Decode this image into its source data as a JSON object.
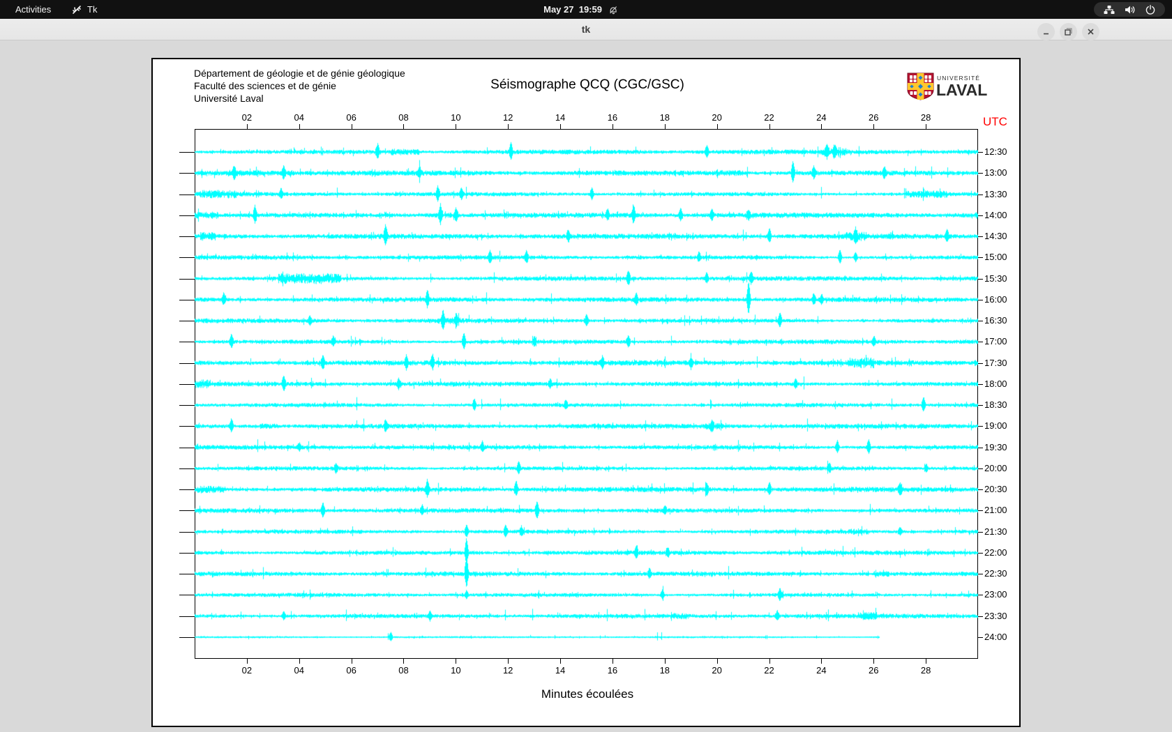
{
  "desktop": {
    "top_bar": {
      "activities_label": "Activities",
      "app_name": "Tk",
      "clock": "May 27  19:59",
      "icons": [
        "do-not-disturb-bell-icon",
        "network-icon",
        "volume-icon",
        "power-icon"
      ]
    },
    "window": {
      "title": "tk",
      "controls": [
        "minimize",
        "maximize",
        "close"
      ]
    }
  },
  "seismograph": {
    "header_lines": [
      "Département de géologie et de génie géologique",
      "Faculté des sciences et de génie",
      "Université Laval"
    ],
    "title": "Séismographe QCQ (CGC/GSC)",
    "logo": {
      "small": "UNIVERSITÉ",
      "large": "LAVAL"
    },
    "utc_label": "UTC",
    "utc_color": "#ff0000",
    "trace_color": "#00ffff",
    "xlabel": "Minutes écoulées",
    "x_ticks": [
      "02",
      "04",
      "06",
      "08",
      "10",
      "12",
      "14",
      "16",
      "18",
      "20",
      "22",
      "24",
      "26",
      "28"
    ],
    "x_range_minutes": [
      0,
      30
    ],
    "traces": [
      {
        "label": "12:30",
        "noise": 1.7,
        "end": 30,
        "ev": [
          [
            7.0,
            11
          ],
          [
            12.1,
            13
          ],
          [
            19.6,
            9
          ],
          [
            24.2,
            8
          ],
          [
            24.5,
            8
          ]
        ],
        "bursts": [
          [
            7.5,
            8.6,
            1.8
          ],
          [
            24.0,
            25.0,
            1.6
          ]
        ]
      },
      {
        "label": "13:00",
        "noise": 1.8,
        "end": 30,
        "ev": [
          [
            1.5,
            8
          ],
          [
            3.4,
            10
          ],
          [
            8.6,
            8
          ],
          [
            22.9,
            15
          ],
          [
            23.7,
            9
          ],
          [
            26.4,
            8
          ]
        ],
        "bursts": [
          [
            1.2,
            3.8,
            1.5
          ],
          [
            20.0,
            21.0,
            1.4
          ]
        ]
      },
      {
        "label": "13:30",
        "noise": 1.6,
        "end": 30,
        "ev": [
          [
            3.3,
            7
          ],
          [
            9.3,
            11
          ],
          [
            10.2,
            8
          ],
          [
            15.2,
            9
          ]
        ],
        "bursts": [
          [
            0.2,
            1.6,
            1.8
          ],
          [
            27.2,
            28.8,
            1.9
          ]
        ]
      },
      {
        "label": "14:00",
        "noise": 1.9,
        "end": 30,
        "ev": [
          [
            2.3,
            13
          ],
          [
            9.4,
            15
          ],
          [
            10.0,
            9
          ],
          [
            15.8,
            8
          ],
          [
            16.8,
            13
          ],
          [
            18.6,
            9
          ],
          [
            19.8,
            8
          ],
          [
            21.2,
            7
          ]
        ],
        "bursts": [
          [
            0.0,
            0.9,
            2.2
          ],
          [
            8.8,
            10.2,
            1.5
          ]
        ]
      },
      {
        "label": "14:30",
        "noise": 1.8,
        "end": 30,
        "ev": [
          [
            7.3,
            15
          ],
          [
            14.3,
            9
          ],
          [
            22.0,
            11
          ],
          [
            25.3,
            8
          ],
          [
            28.8,
            9
          ]
        ],
        "bursts": [
          [
            0.2,
            0.8,
            1.8
          ],
          [
            24.9,
            25.7,
            1.8
          ]
        ]
      },
      {
        "label": "15:00",
        "noise": 1.6,
        "end": 30,
        "ev": [
          [
            11.3,
            9
          ],
          [
            12.7,
            9
          ],
          [
            19.3,
            7
          ],
          [
            24.7,
            11
          ],
          [
            25.3,
            7
          ]
        ],
        "bursts": []
      },
      {
        "label": "15:30",
        "noise": 1.7,
        "end": 30,
        "ev": [
          [
            16.6,
            11
          ],
          [
            19.6,
            8
          ],
          [
            21.3,
            9
          ]
        ],
        "bursts": [
          [
            3.2,
            5.6,
            2.6
          ]
        ]
      },
      {
        "label": "16:00",
        "noise": 1.7,
        "end": 30,
        "ev": [
          [
            1.1,
            8
          ],
          [
            8.9,
            13
          ],
          [
            16.9,
            9
          ],
          [
            21.2,
            26
          ],
          [
            23.7,
            8
          ],
          [
            24.0,
            7
          ]
        ],
        "bursts": []
      },
      {
        "label": "16:30",
        "noise": 1.6,
        "end": 30,
        "ev": [
          [
            4.4,
            7
          ],
          [
            9.5,
            13
          ],
          [
            10.0,
            8
          ],
          [
            15.0,
            9
          ],
          [
            22.4,
            11
          ]
        ],
        "bursts": [
          [
            9.3,
            10.3,
            1.4
          ]
        ]
      },
      {
        "label": "17:00",
        "noise": 1.7,
        "end": 30,
        "ev": [
          [
            1.4,
            11
          ],
          [
            5.3,
            7
          ],
          [
            10.3,
            13
          ],
          [
            13.0,
            7
          ],
          [
            16.6,
            9
          ],
          [
            26.0,
            7
          ]
        ],
        "bursts": []
      },
      {
        "label": "17:30",
        "noise": 1.8,
        "end": 30,
        "ev": [
          [
            4.9,
            11
          ],
          [
            8.1,
            9
          ],
          [
            9.1,
            11
          ],
          [
            15.6,
            8
          ],
          [
            19.0,
            7
          ]
        ],
        "bursts": [
          [
            25.0,
            26.0,
            2.0
          ]
        ]
      },
      {
        "label": "18:00",
        "noise": 1.7,
        "end": 30,
        "ev": [
          [
            3.4,
            11
          ],
          [
            7.8,
            8
          ],
          [
            13.6,
            6
          ],
          [
            23.0,
            6
          ]
        ],
        "bursts": [
          [
            0.0,
            0.6,
            1.8
          ]
        ]
      },
      {
        "label": "18:30",
        "noise": 1.6,
        "end": 30,
        "ev": [
          [
            10.7,
            9
          ],
          [
            14.2,
            6
          ],
          [
            27.9,
            11
          ]
        ],
        "bursts": []
      },
      {
        "label": "19:00",
        "noise": 1.7,
        "end": 30,
        "ev": [
          [
            1.4,
            10
          ],
          [
            7.3,
            8
          ],
          [
            19.8,
            8
          ]
        ],
        "bursts": [
          [
            2.5,
            3.2,
            1.8
          ],
          [
            19.5,
            20.2,
            1.5
          ]
        ]
      },
      {
        "label": "19:30",
        "noise": 1.6,
        "end": 30,
        "ev": [
          [
            4.0,
            6
          ],
          [
            11.0,
            7
          ],
          [
            24.6,
            9
          ],
          [
            25.8,
            11
          ]
        ],
        "bursts": []
      },
      {
        "label": "20:00",
        "noise": 1.6,
        "end": 30,
        "ev": [
          [
            5.4,
            7
          ],
          [
            12.4,
            9
          ],
          [
            24.3,
            7
          ],
          [
            28.0,
            6
          ]
        ],
        "bursts": []
      },
      {
        "label": "20:30",
        "noise": 1.8,
        "end": 30,
        "ev": [
          [
            8.9,
            13
          ],
          [
            12.3,
            11
          ],
          [
            19.6,
            9
          ],
          [
            22.0,
            9
          ],
          [
            27.0,
            9
          ]
        ],
        "bursts": [
          [
            0.1,
            1.2,
            1.8
          ]
        ]
      },
      {
        "label": "21:00",
        "noise": 1.6,
        "end": 30,
        "ev": [
          [
            4.9,
            11
          ],
          [
            8.7,
            7
          ],
          [
            13.1,
            13
          ],
          [
            18.0,
            6
          ]
        ],
        "bursts": []
      },
      {
        "label": "21:30",
        "noise": 1.6,
        "end": 30,
        "ev": [
          [
            10.4,
            9
          ],
          [
            11.9,
            9
          ],
          [
            12.5,
            7
          ],
          [
            27.0,
            6
          ]
        ],
        "bursts": [
          [
            25.0,
            25.8,
            1.6
          ]
        ]
      },
      {
        "label": "22:00",
        "noise": 1.6,
        "end": 30,
        "ev": [
          [
            10.4,
            20
          ],
          [
            16.9,
            9
          ],
          [
            18.1,
            7
          ]
        ],
        "bursts": []
      },
      {
        "label": "22:30",
        "noise": 1.6,
        "end": 30,
        "ev": [
          [
            10.4,
            24
          ],
          [
            17.4,
            7
          ]
        ],
        "bursts": [
          [
            26.0,
            26.6,
            1.6
          ]
        ]
      },
      {
        "label": "23:00",
        "noise": 1.5,
        "end": 30,
        "ev": [
          [
            10.4,
            6
          ],
          [
            17.9,
            7
          ],
          [
            22.4,
            9
          ]
        ],
        "bursts": []
      },
      {
        "label": "23:30",
        "noise": 1.6,
        "end": 30,
        "ev": [
          [
            3.4,
            6
          ],
          [
            9.0,
            7
          ],
          [
            22.3,
            7
          ]
        ],
        "bursts": [
          [
            18.2,
            18.9,
            1.6
          ],
          [
            25.4,
            26.1,
            1.7
          ]
        ]
      },
      {
        "label": "24:00",
        "noise": 0.7,
        "end": 26.2,
        "ev": [
          [
            7.5,
            7
          ]
        ],
        "bursts": []
      }
    ]
  }
}
